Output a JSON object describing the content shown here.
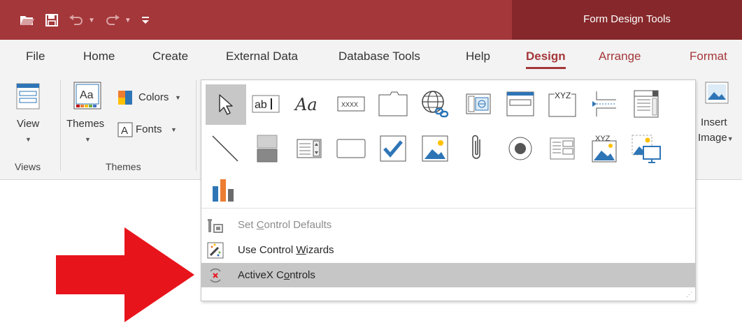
{
  "titlebar": {
    "context_tab": "Form Design Tools"
  },
  "tabs": [
    "File",
    "Home",
    "Create",
    "External Data",
    "Database Tools",
    "Help",
    "Design",
    "Arrange",
    "Format"
  ],
  "active_tab": "Design",
  "ribbon": {
    "views_group": {
      "view_label": "View",
      "group_label": "Views"
    },
    "themes_group": {
      "themes_label": "Themes",
      "colors_label": "Colors",
      "fonts_label": "Fonts",
      "group_label": "Themes"
    },
    "insert_image": {
      "line1": "Insert",
      "line2": "Image"
    }
  },
  "controls_gallery": {
    "row1": [
      "select",
      "text-box",
      "label",
      "button",
      "tab-control",
      "hyperlink",
      "web-browser-control",
      "navigation-control",
      "option-group",
      "insert-page-break",
      "combo-box"
    ],
    "row2": [
      "line",
      "toggle-button",
      "list-box",
      "rectangle",
      "check-box",
      "image",
      "attachment",
      "option-button",
      "subform",
      "bound-object-frame",
      "unbound-object-frame"
    ],
    "row3": [
      "chart"
    ],
    "selected": "select"
  },
  "menu": {
    "items": [
      {
        "pre": "Set ",
        "key": "C",
        "post": "ontrol Defaults",
        "disabled": true
      },
      {
        "pre": "Use Control ",
        "key": "W",
        "post": "izards",
        "disabled": false
      },
      {
        "pre": "ActiveX C",
        "key": "o",
        "post": "ntrols",
        "disabled": false,
        "highlighted": true
      }
    ]
  },
  "colors": {
    "title_bar": "#a4373a",
    "context_tab": "#86282b",
    "arrow": "#e8141c",
    "highlight": "#c6c6c6",
    "icon_blue": "#2e75b6"
  }
}
